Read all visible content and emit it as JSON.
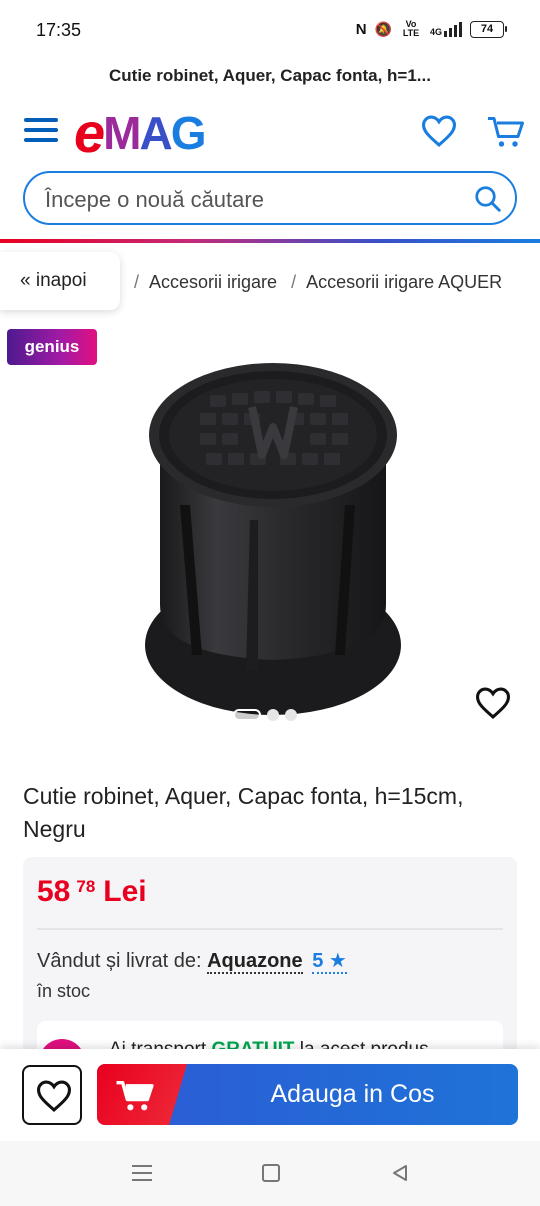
{
  "status_bar": {
    "time": "17:35",
    "network_label": "Vo LTE",
    "network_type": "4G",
    "battery": "74"
  },
  "page_title": "Cutie robinet, Aquer, Capac fonta, h=1...",
  "header": {
    "logo": {
      "e": "e",
      "m": "M",
      "a": "A",
      "g": "G"
    }
  },
  "search": {
    "placeholder": "Începe o nouă căutare"
  },
  "breadcrumb": {
    "back_label": "« inapoi",
    "items": [
      "Accesorii irigare",
      "Accesorii irigare AQUER"
    ]
  },
  "badge": "genius",
  "product": {
    "title": "Cutie robinet, Aquer, Capac fonta, h=15cm, Negru",
    "price_int": "58",
    "price_dec": "78",
    "currency": "Lei",
    "seller_prefix": "Vândut și livrat de:",
    "seller_name": "Aquazone",
    "seller_rating": "5",
    "stock": "în stoc",
    "shipping_prefix": "Ai transport",
    "shipping_free": "GRATUIT",
    "shipping_suffix": "la acest produs"
  },
  "gallery": {
    "total_images": 3,
    "active_index": 0
  },
  "actions": {
    "add_to_cart": "Adauga in Cos"
  },
  "colors": {
    "accent_blue": "#1a7de0",
    "brand_red": "#e9001e",
    "free_green": "#00a651"
  }
}
